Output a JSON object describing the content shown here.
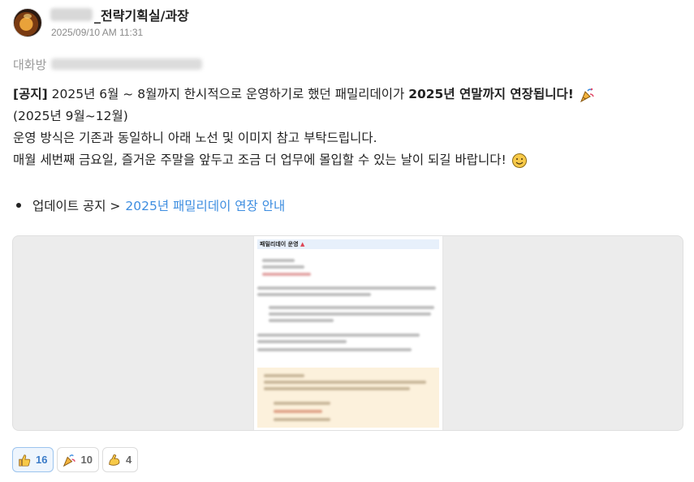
{
  "post": {
    "author_suffix": "_전략기획실/과장",
    "timestamp": "2025/09/10 AM 11:31",
    "room_label": "대화방"
  },
  "message": {
    "line1_tag": "[공지]",
    "line1_text": " 2025년 6월 ~ 8월까지 한시적으로 운영하기로 했던 패밀리데이가 ",
    "line1_bold": "2025년 연말까지 연장됩니다!",
    "line2": "(2025년 9월~12월)",
    "line3": "운영 방식은 기존과 동일하니 아래 노선 및 이미지 참고 부탁드립니다.",
    "line4": "매월 세번째 금요일, 즐거운 주말을 앞두고 조금 더 업무에 몰입할 수 있는 날이 되길 바랍니다!",
    "bullet_prefix": "업데이트 공지 >",
    "bullet_link": "2025년 패밀리데이 연장 안내"
  },
  "attachment": {
    "doc_title": "패밀리데이 운영"
  },
  "reactions": [
    {
      "icon": "thumbs-up-icon",
      "count": "16",
      "active": true
    },
    {
      "icon": "party-popper-icon",
      "count": "10",
      "active": false
    },
    {
      "icon": "flexed-biceps-icon",
      "count": "4",
      "active": false
    }
  ],
  "colors": {
    "link": "#3d8de0",
    "active_reaction": "#3b7bc8",
    "doc_header": "#e7f0fb",
    "callout": "#fcf1dc"
  }
}
